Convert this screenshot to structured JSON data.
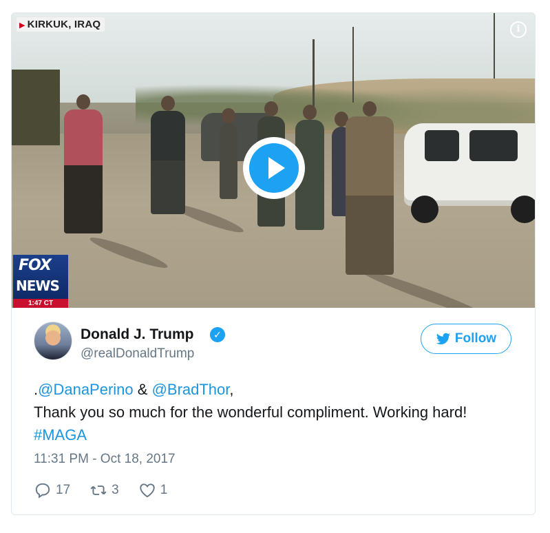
{
  "video": {
    "location_label": "KIRKUK, IRAQ",
    "info_icon": "info-icon",
    "play_icon": "play-icon",
    "network_logo_line1": "FOX",
    "network_logo_line2": "NEWS",
    "broadcast_time": "1:47 CT"
  },
  "tweet": {
    "author_name": "Donald J. Trump",
    "verified_icon": "verified-badge-icon",
    "handle": "@realDonaldTrump",
    "follow_label": "Follow",
    "text": {
      "prefix": ".",
      "mention1": "@DanaPerino",
      "amp": " & ",
      "mention2": "@BradThor",
      "comma": ",",
      "body": "Thank you so much for the wonderful compliment. Working hard! ",
      "hashtag": "#MAGA"
    },
    "timestamp": "11:31 PM - Oct 18, 2017",
    "actions": {
      "replies": "17",
      "retweets": "3",
      "likes": "1"
    }
  },
  "colors": {
    "accent": "#1da1f2",
    "link": "#1b95e0",
    "muted": "#657786"
  }
}
